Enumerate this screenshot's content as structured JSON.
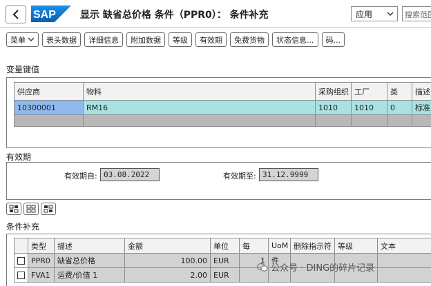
{
  "header": {
    "title": "显示 缺省总价格 条件（PPR0）： 条件补充",
    "apply_label": "应用",
    "search_placeholder": "搜索范围"
  },
  "toolbar": {
    "buttons": [
      "菜单",
      "表头数据",
      "详细信息",
      "附加数据",
      "等级",
      "有效期",
      "免费货物",
      "状态信息...",
      "码..."
    ]
  },
  "variable_key": {
    "title": "变量键值",
    "columns": [
      "供应商",
      "物料",
      "采购组织",
      "工厂",
      "类",
      "描述"
    ],
    "rows": [
      [
        "10300001",
        "RM16",
        "1010",
        "1010",
        "0",
        "标准"
      ]
    ]
  },
  "validity": {
    "title": "有效期",
    "from_label": "有效期自:",
    "from_value": "03.08.2022",
    "to_label": "有效期至:",
    "to_value": "31.12.9999"
  },
  "condition_supplement": {
    "title": "条件补充",
    "columns": [
      "类型",
      "描述",
      "金额",
      "单位",
      "每",
      "UoM",
      "删除指示符",
      "等级",
      "文本"
    ],
    "rows": [
      [
        "PPR0",
        "缺省总价格",
        "100.00",
        "EUR",
        "1",
        "件",
        "",
        "",
        ""
      ],
      [
        "FVA1",
        "运费/价值 1",
        "2.00",
        "EUR",
        "",
        "",
        "",
        "",
        ""
      ]
    ]
  },
  "watermark": {
    "text": "公众号 · DING的碎片记录"
  },
  "colors": {
    "sap_blue": "#0a6ed1",
    "selected_cell": "#8fb9ef",
    "data_row": "#a8e2e1",
    "readonly_field": "#d4d4d4"
  }
}
